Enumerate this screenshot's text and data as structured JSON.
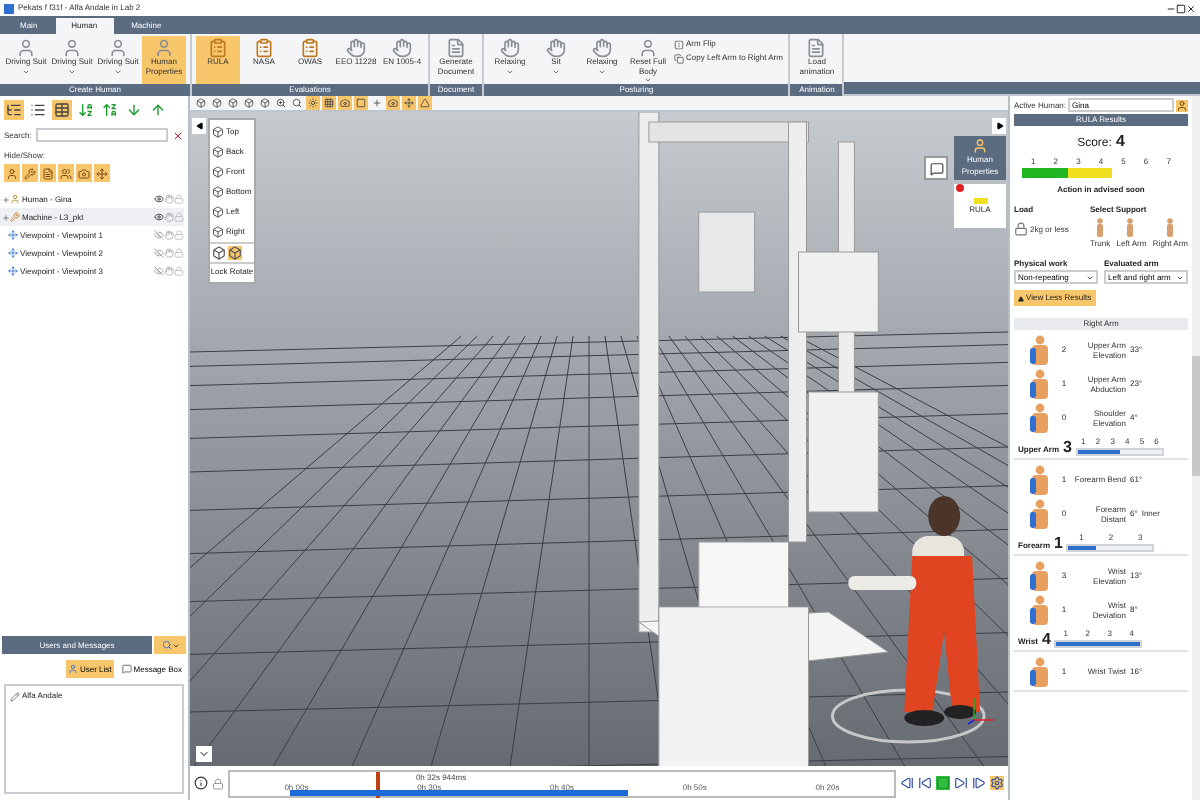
{
  "window": {
    "title": "Pekats f f31f - Alfa Andale in Lab 2"
  },
  "tabs": [
    {
      "label": "Main",
      "selected": false
    },
    {
      "label": "Human",
      "selected": true
    },
    {
      "label": "Machine",
      "selected": false
    }
  ],
  "ribbon": [
    {
      "label": "Create Human",
      "buttons": [
        {
          "label": "Driving Suit",
          "kind": "person",
          "selected": false,
          "dropdown": true
        },
        {
          "label": "Driving Suit",
          "kind": "person",
          "selected": false,
          "dropdown": true
        },
        {
          "label": "Driving Suit",
          "kind": "person",
          "selected": false,
          "dropdown": true
        },
        {
          "label": "Human Properties",
          "kind": "person",
          "selected": true,
          "dropdown": false
        }
      ]
    },
    {
      "label": "Evaluations",
      "buttons": [
        {
          "label": "RULA",
          "kind": "chart",
          "selected": true,
          "dropdown": false
        },
        {
          "label": "NASA",
          "kind": "chart",
          "selected": false,
          "dropdown": false
        },
        {
          "label": "OWAS",
          "kind": "chart",
          "selected": false,
          "dropdown": false
        },
        {
          "label": "EEO 11228",
          "kind": "hand",
          "selected": false,
          "dropdown": false
        },
        {
          "label": "EN 1005-4",
          "kind": "hand",
          "selected": false,
          "dropdown": false
        }
      ]
    },
    {
      "label": "Document",
      "buttons": [
        {
          "label": "Generate Document",
          "kind": "document",
          "selected": false,
          "dropdown": false
        }
      ]
    },
    {
      "label": "Posturing",
      "buttons": [
        {
          "label": "Relaxing",
          "kind": "hand",
          "selected": false,
          "dropdown": true
        },
        {
          "label": "Sit",
          "kind": "hand",
          "selected": false,
          "dropdown": true
        },
        {
          "label": "Relaxing",
          "kind": "hand",
          "selected": false,
          "dropdown": true
        },
        {
          "label": "Reset Full Body",
          "kind": "person",
          "selected": false,
          "dropdown": true
        }
      ],
      "small_buttons": [
        {
          "label": "Arm Flip",
          "kind": "flip"
        },
        {
          "label": "Copy Left Arm to Right Arm",
          "kind": "copy"
        }
      ]
    },
    {
      "label": "Animation",
      "buttons": [
        {
          "label": "Load animation",
          "kind": "document",
          "selected": false,
          "dropdown": false
        }
      ]
    }
  ],
  "left_panel": {
    "search_label": "Search:",
    "hide_show_label": "Hide/Show:",
    "tree": [
      {
        "label": "Human - Gina",
        "kind": "human",
        "visible": true
      },
      {
        "label": "Machine - L3_pkt",
        "kind": "machine",
        "visible": true
      },
      {
        "label": "Viewpoint - Viewpoint 1",
        "kind": "viewpoint",
        "visible": false
      },
      {
        "label": "Viewpoint - Viewpoint 2",
        "kind": "viewpoint",
        "visible": false
      },
      {
        "label": "Viewpoint - Viewpoint 3",
        "kind": "viewpoint",
        "visible": false
      }
    ]
  },
  "users_panel": {
    "title": "Users and Messages",
    "tabs": [
      {
        "label": "User List",
        "selected": true
      },
      {
        "label": "Message Box",
        "selected": false
      }
    ],
    "users": [
      "Alfa Andale"
    ]
  },
  "viewport": {
    "view_menu": [
      "Top",
      "Back",
      "Front",
      "Bottom",
      "Left",
      "Right"
    ],
    "lock_label": "Lock Rotate",
    "side_buttons": [
      {
        "label": "Human Properties",
        "kind": "person"
      },
      {
        "label": "RULA",
        "kind": "rula"
      }
    ]
  },
  "timeline": {
    "current": "0h 32s 944ms",
    "ticks": [
      "0h 00s",
      "0h 30s",
      "0h 40s",
      "0h 50s",
      "0h 20s"
    ]
  },
  "rula": {
    "active_human_label": "Active Human:",
    "active_human": "Gina",
    "title": "RULA Results",
    "score_label": "Score:",
    "score": "4",
    "scale": [
      {
        "label": "1",
        "color": "#22b522"
      },
      {
        "label": "2",
        "color": "#22b522"
      },
      {
        "label": "3",
        "color": "#f0e020"
      },
      {
        "label": "4",
        "color": "#f0e020"
      },
      {
        "label": "5"
      },
      {
        "label": "6"
      },
      {
        "label": "7"
      }
    ],
    "advice": "Action in advised soon",
    "load_label": "Load",
    "load_value": "2kg or less",
    "support_label": "Select Support",
    "supports": [
      "Trunk",
      "Left Arm",
      "Right Arm"
    ],
    "physical_work_label": "Physical work",
    "physical_work": "Non-repeating",
    "evaluated_arm_label": "Evaluated arm",
    "evaluated_arm": "Left and right arm",
    "toggle": "View Less Results",
    "section_title": "Right Arm",
    "groups": [
      {
        "rows": [
          {
            "score": "2",
            "name": "Upper Arm Elevation",
            "angle": "33°"
          },
          {
            "score": "1",
            "name": "Upper Arm Abduction",
            "angle": "23°"
          },
          {
            "score": "0",
            "name": "Shoulder Elevation",
            "angle": "4°"
          }
        ],
        "total_label": "Upper Arm",
        "total": "3",
        "scale": [
          "1",
          "2",
          "3",
          "4",
          "5",
          "6"
        ],
        "level": 0.5
      },
      {
        "rows": [
          {
            "score": "1",
            "name": "Forearm Bend",
            "angle": "61°"
          },
          {
            "score": "0",
            "name": "Forearm Distant",
            "angle": "6°",
            "note": "Inner"
          }
        ],
        "total_label": "Forearm",
        "total": "1",
        "scale": [
          "1",
          "2",
          "3"
        ],
        "level": 0.33
      },
      {
        "rows": [
          {
            "score": "3",
            "name": "Wrist Elevation",
            "angle": "13°"
          },
          {
            "score": "1",
            "name": "Wrist Deviation",
            "angle": "8°"
          }
        ],
        "total_label": "Wrist",
        "total": "4",
        "scale": [
          "1",
          "2",
          "3",
          "4"
        ],
        "level": 1
      },
      {
        "rows": [
          {
            "score": "1",
            "name": "Wrist Twist",
            "angle": "16°"
          }
        ]
      }
    ]
  }
}
